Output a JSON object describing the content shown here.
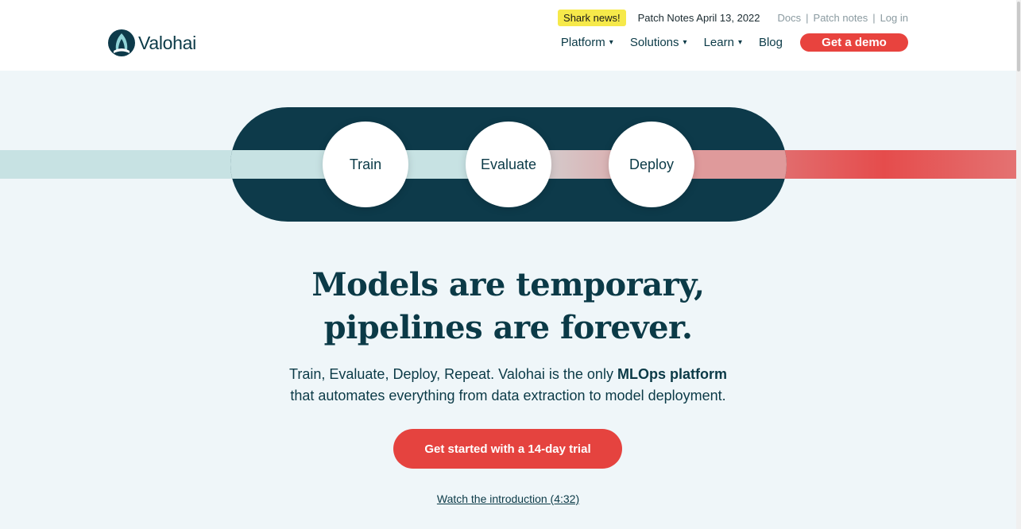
{
  "brand": {
    "name": "Valohai"
  },
  "topbar": {
    "badge": "Shark news!",
    "patch_title": "Patch Notes April 13, 2022",
    "links": [
      "Docs",
      "Patch notes",
      "Log in"
    ]
  },
  "nav": {
    "items": [
      {
        "label": "Platform",
        "dropdown": true
      },
      {
        "label": "Solutions",
        "dropdown": true
      },
      {
        "label": "Learn",
        "dropdown": true
      },
      {
        "label": "Blog",
        "dropdown": false
      }
    ],
    "demo_label": "Get a demo",
    "caret": "▾"
  },
  "pipeline": {
    "steps": [
      "Train",
      "Evaluate",
      "Deploy"
    ]
  },
  "hero": {
    "headline_line1": "Models are temporary,",
    "headline_line2": "pipelines are forever.",
    "sub_line1_pre": "Train, Evaluate, Deploy, Repeat. Valohai is the only ",
    "sub_line1_bold": "MLOps platform",
    "sub_line2": "that automates everything from data extraction to model deployment.",
    "cta_label": "Get started with a 14-day trial",
    "watch_label": "Watch the introduction (4:32)"
  },
  "colors": {
    "primary_dark": "#0d3a4a",
    "accent_red": "#e5433f",
    "badge_yellow": "#f6e94a",
    "hero_bg": "#eff6f9"
  }
}
